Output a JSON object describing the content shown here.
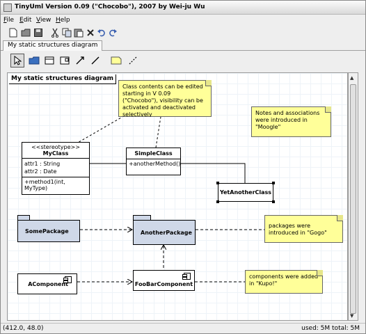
{
  "window": {
    "title": "TinyUml Version 0.09 (\"Chocobo\"), 2007 by Wei-ju Wu"
  },
  "menu": [
    {
      "mnemonic": "F",
      "rest": "ile"
    },
    {
      "mnemonic": "E",
      "rest": "dit"
    },
    {
      "mnemonic": "V",
      "rest": "iew"
    },
    {
      "mnemonic": "H",
      "rest": "elp"
    }
  ],
  "toolbar_main": [
    "new-icon",
    "open-icon",
    "save-icon",
    "cut-icon",
    "copy-icon",
    "paste-icon",
    "delete-icon",
    "undo-icon",
    "redo-icon"
  ],
  "toolbar_diagram": [
    "select-icon",
    "package-icon",
    "class-icon",
    "component-icon",
    "association-icon",
    "line-icon",
    "note-icon",
    "note-connector-icon"
  ],
  "tab": {
    "label": "My static structures diagram"
  },
  "diagram": {
    "frame_label": "My static structures diagram",
    "myclass": {
      "stereotype": "<<stereotype>>",
      "name": "MyClass",
      "attr1": "attr1 : String",
      "attr2": "attr2 : Date",
      "method": "+method1(int, MyType)"
    },
    "simpleclass": {
      "name": "SimpleClass",
      "method": "+anotherMethod()"
    },
    "yetanotherclass": {
      "name": "YetAnotherClass"
    },
    "somepackage": "SomePackage",
    "anotherpackage": "AnotherPackage",
    "acomponent": "AComponent",
    "foobarcomponent": "FooBarComponent",
    "note1": "Class contents can be edited starting in V 0.09 (\"Chocobo\"), visibility can be activated and deactivated selectively",
    "note2": "Notes and associations were introduced in \"Moogle\"",
    "note3": "packages were introduced in \"Gogo\"",
    "note4": "components were added in \"Kupo!\""
  },
  "status": {
    "coords": "(412.0, 48.0)",
    "memory": "used: 5M total: 5M"
  },
  "colors": {
    "note": "#ffff99",
    "package": "#cfd8e8",
    "window_bg": "#eeeeee"
  }
}
